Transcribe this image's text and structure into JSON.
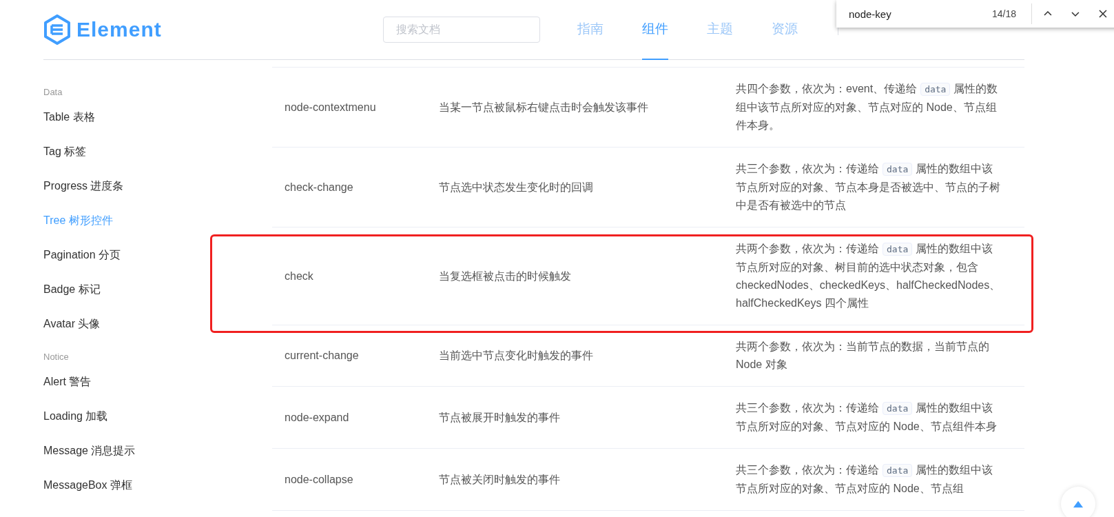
{
  "header": {
    "logo_text": "Element",
    "search": {
      "placeholder": "搜索文档"
    },
    "nav": [
      {
        "label": "指南",
        "selected": false
      },
      {
        "label": "组件",
        "selected": true
      },
      {
        "label": "主题",
        "selected": false
      },
      {
        "label": "资源",
        "selected": false
      }
    ]
  },
  "find_bar": {
    "query": "node-key",
    "count": "14/18"
  },
  "sidebar": {
    "groups": [
      {
        "title": "Data",
        "items": [
          {
            "label": "Table 表格",
            "selected": false
          },
          {
            "label": "Tag 标签",
            "selected": false
          },
          {
            "label": "Progress 进度条",
            "selected": false
          },
          {
            "label": "Tree 树形控件",
            "selected": true
          },
          {
            "label": "Pagination 分页",
            "selected": false
          },
          {
            "label": "Badge 标记",
            "selected": false
          },
          {
            "label": "Avatar 头像",
            "selected": false
          }
        ]
      },
      {
        "title": "Notice",
        "items": [
          {
            "label": "Alert 警告",
            "selected": false
          },
          {
            "label": "Loading 加载",
            "selected": false
          },
          {
            "label": "Message 消息提示",
            "selected": false
          },
          {
            "label": "MessageBox 弹框",
            "selected": false
          }
        ]
      }
    ]
  },
  "events_table": {
    "rows": [
      {
        "name": "node-contextmenu",
        "description": "当某一节点被鼠标右键点击时会触发该事件",
        "highlighted": false,
        "params": [
          {
            "kind": "text",
            "text": "共四个参数，依次为：event、传递给"
          },
          {
            "kind": "code",
            "text": "data"
          },
          {
            "kind": "text",
            "text": "属性的数组中该节点所对应的对象、节点对应的 Node、节点组件本身。"
          }
        ]
      },
      {
        "name": "check-change",
        "description": "节点选中状态发生变化时的回调",
        "highlighted": false,
        "params": [
          {
            "kind": "text",
            "text": "共三个参数，依次为：传递给"
          },
          {
            "kind": "code",
            "text": "data"
          },
          {
            "kind": "text",
            "text": "属性的数组中该节点所对应的对象、节点本身是否被选中、节点的子树中是否有被选中的节点"
          }
        ]
      },
      {
        "name": "check",
        "description": "当复选框被点击的时候触发",
        "highlighted": true,
        "params": [
          {
            "kind": "text",
            "text": "共两个参数，依次为：传递给"
          },
          {
            "kind": "code",
            "text": "data"
          },
          {
            "kind": "text",
            "text": "属性的数组中该节点所对应的对象、树目前的选中状态对象，包含 checkedNodes、checkedKeys、halfCheckedNodes、halfCheckedKeys 四个属性"
          }
        ]
      },
      {
        "name": "current-change",
        "description": "当前选中节点变化时触发的事件",
        "highlighted": false,
        "params": [
          {
            "kind": "text",
            "text": "共两个参数，依次为：当前节点的数据，当前节点的 Node 对象"
          }
        ]
      },
      {
        "name": "node-expand",
        "description": "节点被展开时触发的事件",
        "highlighted": false,
        "params": [
          {
            "kind": "text",
            "text": "共三个参数，依次为：传递给"
          },
          {
            "kind": "code",
            "text": "data"
          },
          {
            "kind": "text",
            "text": "属性的数组中该节点所对应的对象、节点对应的 Node、节点组件本身"
          }
        ]
      },
      {
        "name": "node-collapse",
        "description": "节点被关闭时触发的事件",
        "highlighted": false,
        "params": [
          {
            "kind": "text",
            "text": "共三个参数，依次为：传递给"
          },
          {
            "kind": "code",
            "text": "data"
          },
          {
            "kind": "text",
            "text": "属性的数组中该节点所对应的对象、节点对应的 Node、节点组"
          }
        ]
      }
    ]
  }
}
